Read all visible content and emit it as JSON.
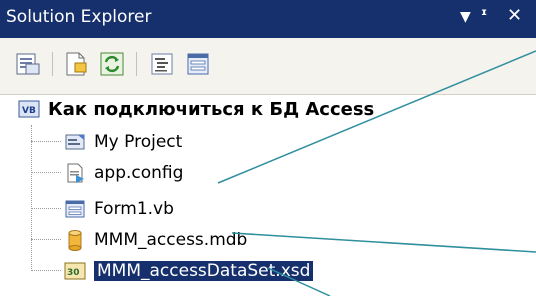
{
  "window": {
    "title": "Solution Explorer",
    "controls": {
      "dropdown": "▾",
      "pin": "ᵰ",
      "close": "✕"
    },
    "accent": "#16306d"
  },
  "toolbar": {
    "buttons": [
      "properties-icon",
      "show-all-files-icon",
      "refresh-icon",
      "view-code-icon",
      "view-designer-icon"
    ]
  },
  "tree": {
    "root": {
      "label": "Как подключиться к БД Access",
      "icon": "vb-project-icon"
    },
    "items": [
      {
        "label": "My Project",
        "icon": "my-project-icon"
      },
      {
        "label": "app.config",
        "icon": "config-file-icon"
      },
      {
        "label": "Form1.vb",
        "icon": "form-icon"
      },
      {
        "label": "MMM_access.mdb",
        "icon": "database-icon"
      },
      {
        "label": "MMM_accessDataSet.xsd",
        "icon": "dataset-icon",
        "selected": true
      }
    ]
  }
}
